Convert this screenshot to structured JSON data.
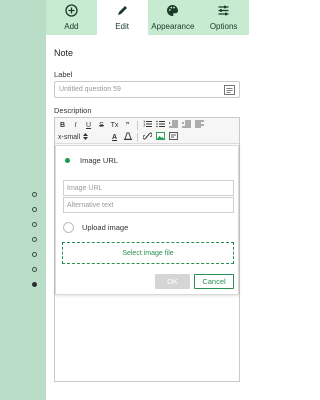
{
  "tabs": [
    {
      "label": "Add",
      "icon": "plus-circle-icon"
    },
    {
      "label": "Edit",
      "icon": "pencil-icon"
    },
    {
      "label": "Appearance",
      "icon": "palette-icon"
    },
    {
      "label": "Options",
      "icon": "sliders-icon"
    }
  ],
  "active_tab": "Edit",
  "panel": {
    "title": "Note",
    "label_field": {
      "label": "Label",
      "placeholder": "Untitled question 59"
    },
    "description_label": "Description"
  },
  "toolbar": {
    "row1": [
      "B",
      "I",
      "U",
      "S",
      "Tx",
      "”"
    ],
    "row2_size": "x-small",
    "row2_text_color": "A"
  },
  "image_dialog": {
    "option_url": "Image URL",
    "url_placeholder": "Image URL",
    "alt_placeholder": "Alternative text",
    "option_upload": "Upload image",
    "select_file": "Select image file",
    "ok": "OK",
    "cancel": "Cancel"
  },
  "colors": {
    "rail": "#b9ddc6",
    "tabbar": "#c6ebd0",
    "accent": "#2a8f52"
  }
}
